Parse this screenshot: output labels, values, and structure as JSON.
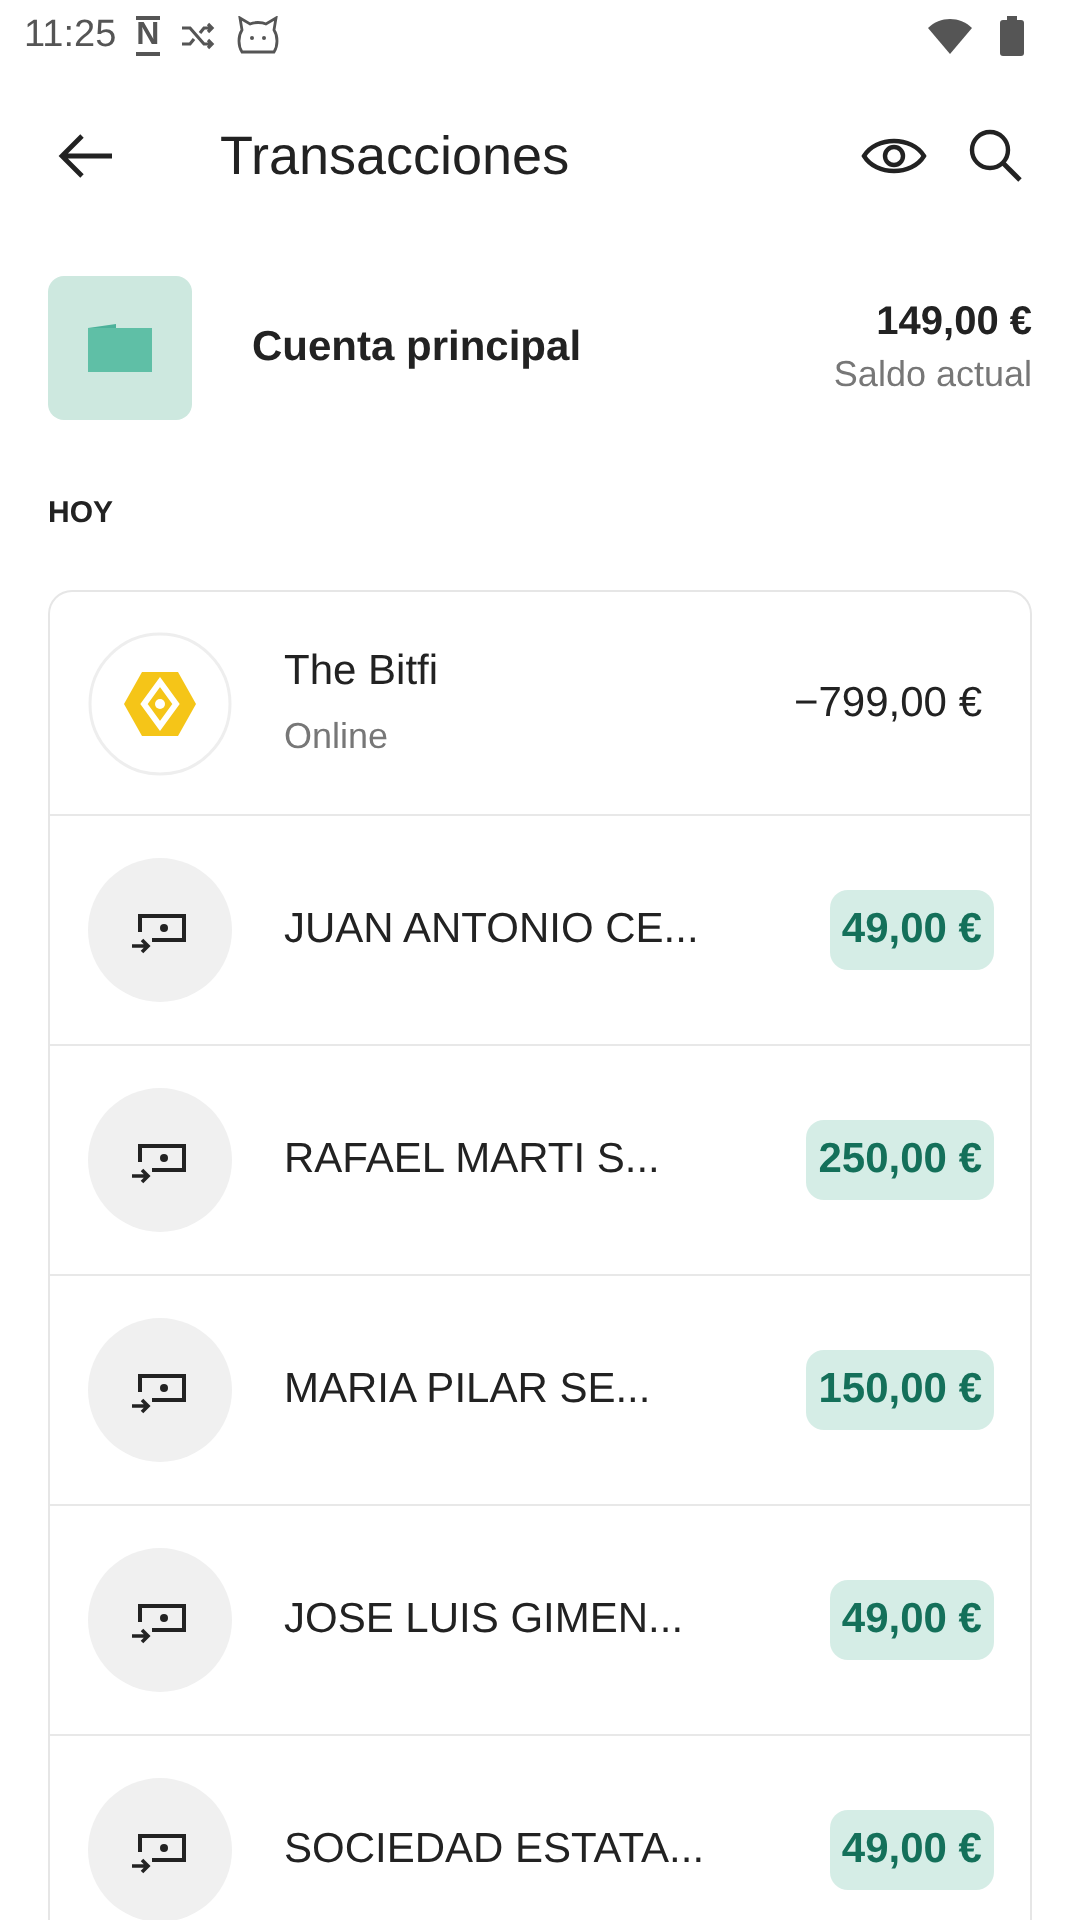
{
  "status_bar": {
    "time": "11:25",
    "notification_letter": "N"
  },
  "header": {
    "title": "Transacciones"
  },
  "account": {
    "name": "Cuenta principal",
    "balance": "149,00 €",
    "balance_label": "Saldo actual"
  },
  "section_label": "HOY",
  "transactions": [
    {
      "kind": "merchant",
      "name": "The Bitfi",
      "subtitle": "Online",
      "amount": "−799,00 €",
      "incoming": false
    },
    {
      "kind": "transfer",
      "name": "JUAN ANTONIO CE...",
      "amount": "49,00 €",
      "incoming": true
    },
    {
      "kind": "transfer",
      "name": "RAFAEL MARTI S...",
      "amount": "250,00 €",
      "incoming": true
    },
    {
      "kind": "transfer",
      "name": "MARIA PILAR SE...",
      "amount": "150,00 €",
      "incoming": true
    },
    {
      "kind": "transfer",
      "name": "JOSE LUIS GIMEN...",
      "amount": "49,00 €",
      "incoming": true
    },
    {
      "kind": "transfer",
      "name": "SOCIEDAD ESTATA...",
      "amount": "49,00 €",
      "incoming": true
    }
  ]
}
